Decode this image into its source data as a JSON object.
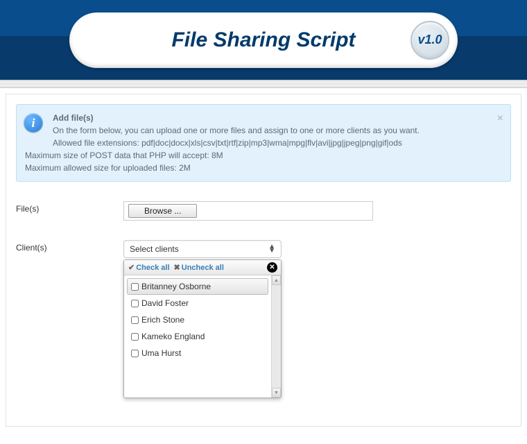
{
  "header": {
    "title": "File Sharing Script",
    "version": "v1.0"
  },
  "info": {
    "title": "Add file(s)",
    "line1": "On the form below, you can upload one or more files and assign to one or more clients as you want.",
    "line2": "Allowed file extensions: pdf|doc|docx|xls|csv|txt|rtf|zip|mp3|wma|mpg|flv|avi|jpg|jpeg|png|gif|ods",
    "line3": "Maximum size of POST data that PHP will accept: 8M",
    "line4": "Maximum allowed size for uploaded files: 2M"
  },
  "form": {
    "files_label": "File(s)",
    "browse_label": "Browse ...",
    "clients_label": "Client(s)",
    "clients_placeholder": "Select clients"
  },
  "dropdown": {
    "check_all": "Check all",
    "uncheck_all": "Uncheck all",
    "items": [
      "Britanney Osborne",
      "David Foster",
      "Erich Stone",
      "Kameko England",
      "Uma Hurst"
    ]
  }
}
